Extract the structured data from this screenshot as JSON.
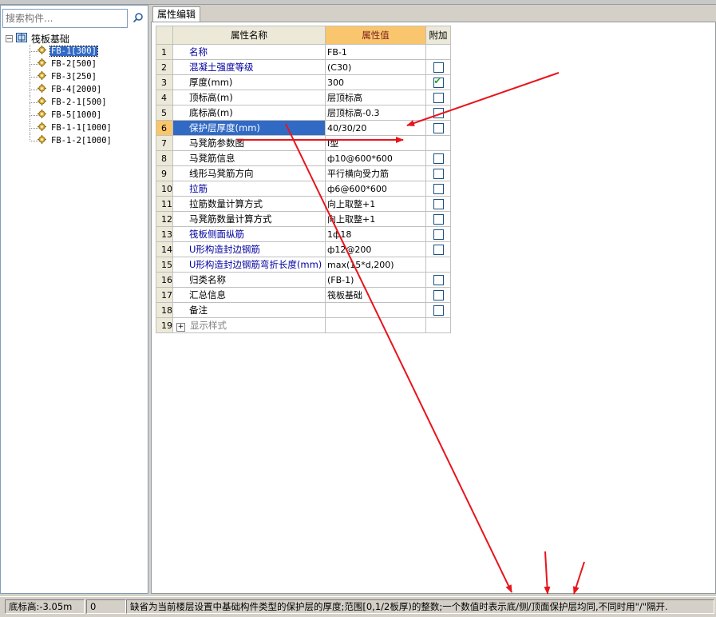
{
  "search": {
    "placeholder": "搜索构件..."
  },
  "tree": {
    "root": "筏板基础",
    "items": [
      "FB-1[300]",
      "FB-2[500]",
      "FB-3[250]",
      "FB-4[2000]",
      "FB-2-1[500]",
      "FB-5[1000]",
      "FB-1-1[1000]",
      "FB-1-2[1000]"
    ],
    "selected_index": 0
  },
  "panel": {
    "tab_label": "属性编辑"
  },
  "table": {
    "headers": {
      "name": "属性名称",
      "value": "属性值",
      "extra": "附加"
    },
    "rows": [
      {
        "num": "1",
        "name": "名称",
        "value": "FB-1",
        "style": "blue",
        "checkbox": false
      },
      {
        "num": "2",
        "name": "混凝土强度等级",
        "value": "(C30)",
        "style": "blue",
        "checkbox": "unchecked"
      },
      {
        "num": "3",
        "name": "厚度(mm)",
        "value": "300",
        "style": "normal",
        "checkbox": "checked"
      },
      {
        "num": "4",
        "name": "顶标高(m)",
        "value": "层顶标高",
        "style": "normal",
        "checkbox": "unchecked"
      },
      {
        "num": "5",
        "name": "底标高(m)",
        "value": "层顶标高-0.3",
        "style": "normal",
        "checkbox": "unchecked"
      },
      {
        "num": "6",
        "name": "保护层厚度(mm)",
        "value": "40/30/20",
        "style": "selected",
        "checkbox": "unchecked"
      },
      {
        "num": "7",
        "name": "马凳筋参数图",
        "value": "I型",
        "style": "normal",
        "checkbox": false
      },
      {
        "num": "8",
        "name": "马凳筋信息",
        "value": "ф10@600*600",
        "style": "normal",
        "checkbox": "unchecked"
      },
      {
        "num": "9",
        "name": "线形马凳筋方向",
        "value": "平行横向受力筋",
        "style": "normal",
        "checkbox": "unchecked"
      },
      {
        "num": "10",
        "name": "拉筋",
        "value": "ф6@600*600",
        "style": "blue",
        "checkbox": "unchecked"
      },
      {
        "num": "11",
        "name": "拉筋数量计算方式",
        "value": "向上取整+1",
        "style": "normal",
        "checkbox": "unchecked"
      },
      {
        "num": "12",
        "name": "马凳筋数量计算方式",
        "value": "向上取整+1",
        "style": "normal",
        "checkbox": "unchecked"
      },
      {
        "num": "13",
        "name": "筏板侧面纵筋",
        "value": "1ф18",
        "style": "blue",
        "checkbox": "unchecked"
      },
      {
        "num": "14",
        "name": "U形构造封边钢筋",
        "value": "ф12@200",
        "style": "blue",
        "checkbox": "unchecked"
      },
      {
        "num": "15",
        "name": "U形构造封边钢筋弯折长度(mm)",
        "value": "max(15*d,200)",
        "style": "blue",
        "checkbox": false
      },
      {
        "num": "16",
        "name": "归类名称",
        "value": "(FB-1)",
        "style": "normal",
        "checkbox": "unchecked"
      },
      {
        "num": "17",
        "name": "汇总信息",
        "value": "筏板基础",
        "style": "normal",
        "checkbox": "unchecked"
      },
      {
        "num": "18",
        "name": "备注",
        "value": "",
        "style": "normal",
        "checkbox": "unchecked"
      },
      {
        "num": "19",
        "name": "显示样式",
        "value": "",
        "style": "grey",
        "checkbox": false,
        "expander": "+"
      }
    ]
  },
  "status": {
    "elevation": "底标高:-3.05m",
    "count": "0",
    "hint": "缺省为当前楼层设置中基础构件类型的保护层的厚度;范围[0,1/2板厚)的整数;一个数值时表示底/侧/顶面保护层均同,不同时用\"/\"隔开."
  },
  "colors": {
    "accent": "#316ac5",
    "header_value_bg": "#f9c66d",
    "annotation": "#e8141c"
  }
}
